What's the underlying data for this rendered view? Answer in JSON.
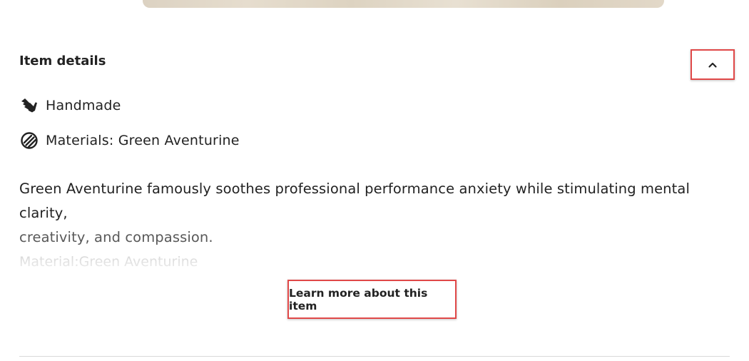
{
  "item_details": {
    "title": "Item details",
    "collapse_icon": "chevron-up-icon",
    "highlights": [
      {
        "icon": "hand-icon",
        "label": "Handmade"
      },
      {
        "icon": "materials-icon",
        "label": "Materials: Green Aventurine"
      }
    ],
    "description": {
      "line1": "Green Aventurine famously soothes professional performance anxiety while stimulating mental clarity,",
      "line2": "creativity, and compassion."
    },
    "faded_text": "Material:Green Aventurine",
    "learn_more_label": "Learn more about this item"
  },
  "colors": {
    "highlight_border": "#e04848",
    "text": "#222222",
    "muted_text": "#595959",
    "faded_text": "#c9c9c9",
    "divider": "#d9d9d9"
  }
}
